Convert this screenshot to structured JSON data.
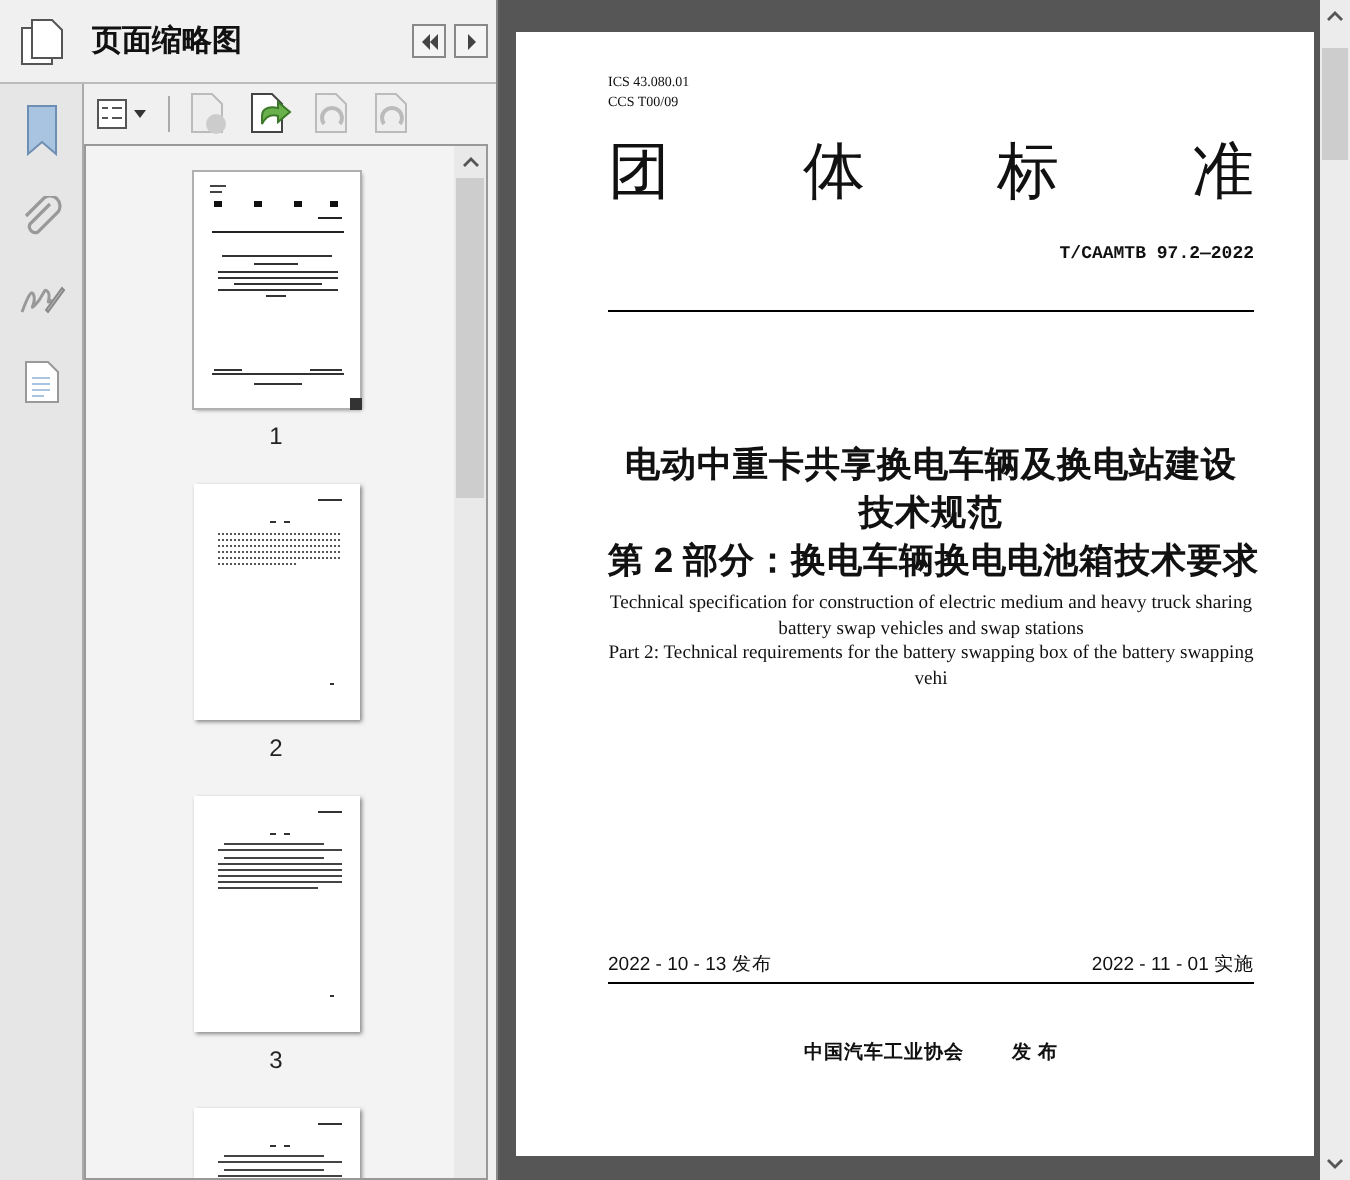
{
  "panel": {
    "title": "页面缩略图"
  },
  "thumbnails": [
    {
      "label": "1",
      "selected": true,
      "kind": "cover"
    },
    {
      "label": "2",
      "selected": false,
      "kind": "contents"
    },
    {
      "label": "3",
      "selected": false,
      "kind": "text"
    },
    {
      "selected": false,
      "kind": "text"
    }
  ],
  "document": {
    "ics": "ICS 43.080.01",
    "ccs": "CCS T00/09",
    "heading": "团体标准",
    "standard_number": "T/CAAMTB 97.2—2022",
    "title_lines": [
      "电动中重卡共享换电车辆及换电站建设",
      "技术规范"
    ],
    "part_title": "第 2 部分：换电车辆换电电池箱技术要求",
    "english_title": "Technical specification for construction of electric medium and heavy truck sharing battery swap vehicles and swap stations",
    "english_part": "Part 2: Technical requirements for the battery swapping box of the battery swapping vehi",
    "publish_date": "2022 - 10 - 13 发布",
    "effective_date": "2022 - 11 - 01 实施",
    "publisher": "中国汽车工业协会",
    "publisher_action": "发 布"
  }
}
